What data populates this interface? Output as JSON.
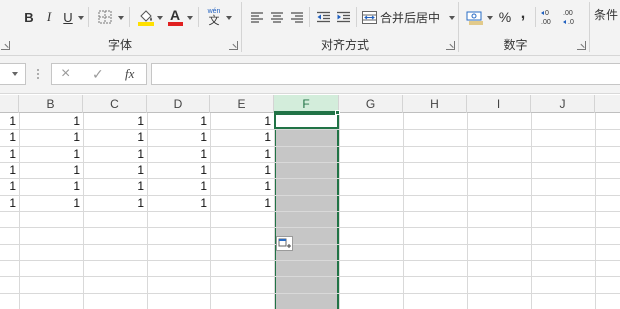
{
  "ribbon": {
    "font_group_label": "字体",
    "align_group_label": "对齐方式",
    "number_group_label": "数字",
    "merge_label": "合并后居中",
    "cond_format_label": "条件",
    "bold_label": "B",
    "italic_label": "I",
    "underline_label": "U",
    "font_color_label": "A",
    "phonetic_top": "wén",
    "phonetic_bottom": "文",
    "percent_label": "%",
    "comma_label": ",",
    "font_color": "#e02020",
    "fill_color": "#ffe000"
  },
  "formula_bar": {
    "fx_label": "fx",
    "cancel_icon": "×",
    "enter_icon": "✓",
    "value": ""
  },
  "columns": [
    "",
    "B",
    "C",
    "D",
    "E",
    "F",
    "G",
    "H",
    "I",
    "J"
  ],
  "selected_column": "F",
  "rows": [
    [
      "1",
      "1",
      "1",
      "1",
      "1"
    ],
    [
      "1",
      "1",
      "1",
      "1",
      "1"
    ],
    [
      "1",
      "1",
      "1",
      "1",
      "1"
    ],
    [
      "1",
      "1",
      "1",
      "1",
      "1"
    ],
    [
      "1",
      "1",
      "1",
      "1",
      "1"
    ],
    [
      "1",
      "1",
      "1",
      "1",
      "1"
    ]
  ],
  "colors": {
    "accent": "#217346",
    "selection": "#c6c6c6",
    "header_selected": "#d3eddb"
  }
}
